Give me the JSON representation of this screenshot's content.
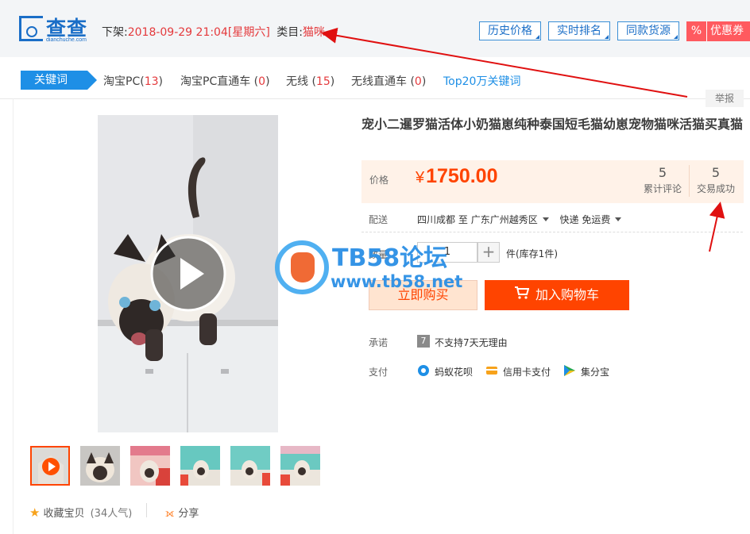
{
  "header": {
    "logo_text": "查查",
    "logo_sub": "dianchuche.com",
    "shelf_prefix": "下架:",
    "shelf_time": "2018-09-29 21:04[星期六]",
    "category_prefix": "类目:",
    "category_value": "猫咪",
    "buttons": [
      "历史价格",
      "实时排名",
      "同款货源"
    ],
    "coupon_icon": "%",
    "coupon_label": "优惠券"
  },
  "tabs": {
    "keyword": "关键词",
    "items": [
      {
        "label": "淘宝PC",
        "count": "13"
      },
      {
        "label": "淘宝PC直通车",
        "count": "0"
      },
      {
        "label": "无线",
        "count": "15"
      },
      {
        "label": "无线直通车",
        "count": "0"
      }
    ],
    "top20": "Top20万关键词",
    "open_paren": "(",
    "close_paren": ")"
  },
  "report": "举报",
  "product": {
    "title": "宠小二暹罗猫活体小奶猫崽纯种泰国短毛猫幼崽宠物猫咪活猫买真猫",
    "price_label": "价格",
    "currency": "¥",
    "price": "1750.00",
    "reviews_count": "5",
    "reviews_label": "累计评论",
    "deals_count": "5",
    "deals_label": "交易成功",
    "shipping_label": "配送",
    "ship_from": "四川成都",
    "ship_to_word": "至",
    "ship_to": "广东广州越秀区",
    "ship_method": "快递 免运费",
    "quantity_label": "数量",
    "quantity": "1",
    "quantity_plus": "+",
    "quantity_unit": "件(库存1件)",
    "buy_now": "立即购买",
    "add_cart": "加入购物车",
    "promise_label": "承诺",
    "promise_icon": "7",
    "promise_text": "不支持7天无理由",
    "pay_label": "支付",
    "pay_methods": [
      "蚂蚁花呗",
      "信用卡支付",
      "集分宝"
    ]
  },
  "footer": {
    "favorite": "收藏宝贝",
    "favorite_count": "(34人气)",
    "share": "分享"
  },
  "watermark": {
    "title": "TB58论坛",
    "url": "www.tb58.net"
  },
  "colors": {
    "accent_blue": "#1e8fe6",
    "price_orange": "#ff4400",
    "red_text": "#e4393c",
    "arrow_red": "#e01010"
  }
}
